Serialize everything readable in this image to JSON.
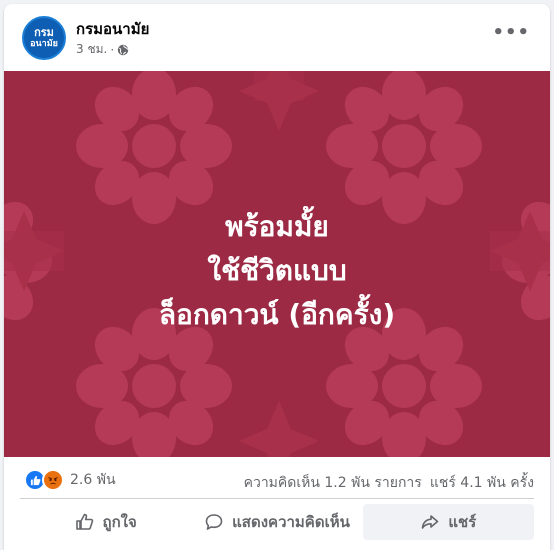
{
  "post": {
    "page_name": "กรมอนามัย",
    "avatar_top": "กรม",
    "avatar_bottom": "อนามัย",
    "time": "3 ชม.",
    "separator": "·",
    "audience_icon": "globe-icon",
    "more_icon": "more-options-icon",
    "more_label": "•••"
  },
  "image": {
    "line1": "พร้อมมั้ย",
    "line2": "ใช้ชีวิตแบบ",
    "line3": "ล็อกดาวน์ (อีกครั้ง)",
    "bg_color": "#9c2a44",
    "pattern_color": "#b53a57"
  },
  "stats": {
    "reaction_icons": [
      "like-icon",
      "angry-icon"
    ],
    "reaction_count": "2.6 พัน",
    "comments": "ความคิดเห็น 1.2 พัน รายการ",
    "shares": "แชร์ 4.1 พัน ครั้ง"
  },
  "actions": {
    "like_label": "ถูกใจ",
    "comment_label": "แสดงความคิดเห็น",
    "share_label": "แชร์"
  }
}
